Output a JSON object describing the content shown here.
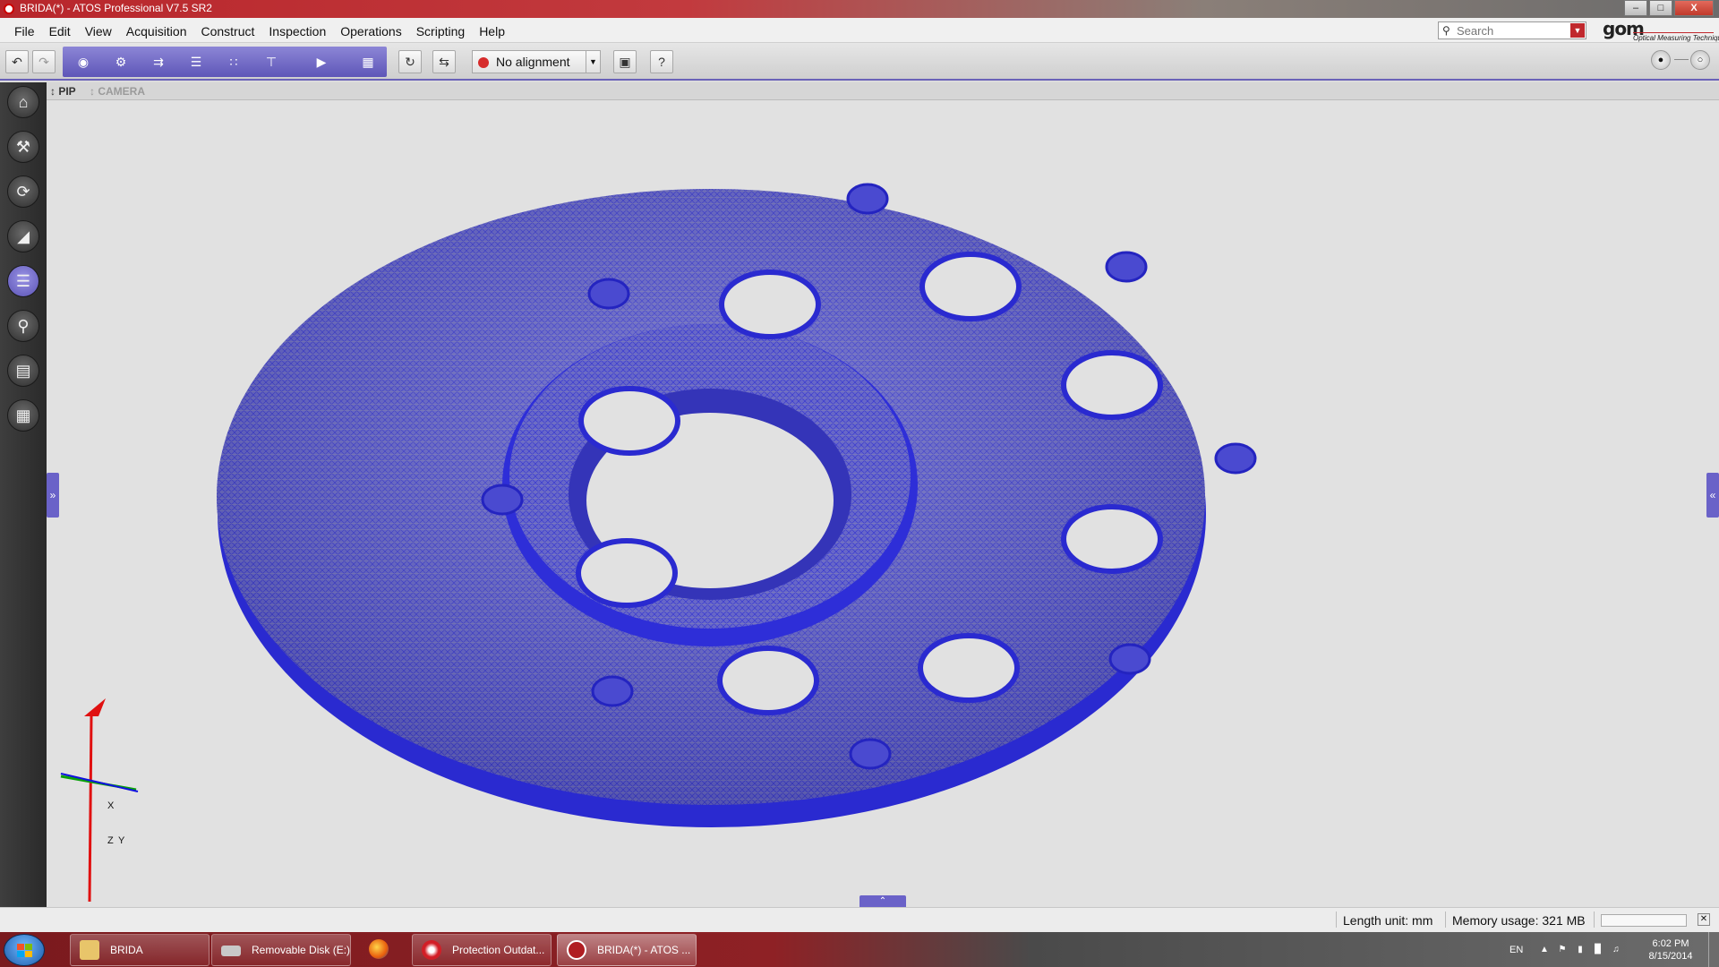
{
  "window": {
    "title": "BRIDA(*) - ATOS Professional V7.5 SR2",
    "buttons": [
      "–",
      "□",
      "X"
    ]
  },
  "menu": {
    "items": [
      "File",
      "Edit",
      "View",
      "Acquisition",
      "Construct",
      "Inspection",
      "Operations",
      "Scripting",
      "Help"
    ]
  },
  "search": {
    "placeholder": "Search"
  },
  "logo": {
    "brand": "gom",
    "tagline": "Optical Measuring Techniques"
  },
  "toolbar": {
    "undo_icon": "undo-icon",
    "redo_icon": "redo-icon",
    "alignment": {
      "selected": "No alignment"
    },
    "help_label": "?"
  },
  "subheader": {
    "pip": "PIP",
    "camera": "CAMERA"
  },
  "viewport": {
    "object": "3D mesh of flange part (BRIDA)",
    "mesh_color": "#3030d8",
    "axis_labels": {
      "x": "X",
      "y": "Y",
      "z": "Z"
    }
  },
  "statusbar": {
    "length_unit": "Length unit: mm",
    "memory": "Memory usage: 321 MB",
    "progress_fraction": 0
  },
  "taskbar": {
    "tasks": [
      {
        "label": "BRIDA",
        "icon": "folder-icon"
      },
      {
        "label": "Removable Disk (E:)",
        "icon": "drive-icon"
      },
      {
        "label": "",
        "icon": "firefox-icon"
      },
      {
        "label": "Protection Outdat...",
        "icon": "trend-micro-icon"
      },
      {
        "label": "BRIDA(*) - ATOS ...",
        "icon": "atos-icon"
      }
    ],
    "tray": {
      "language": "EN",
      "time": "6:02 PM",
      "date": "8/15/2014"
    }
  },
  "colors": {
    "accent": "#6a62c8",
    "brand_red": "#c0282d"
  }
}
